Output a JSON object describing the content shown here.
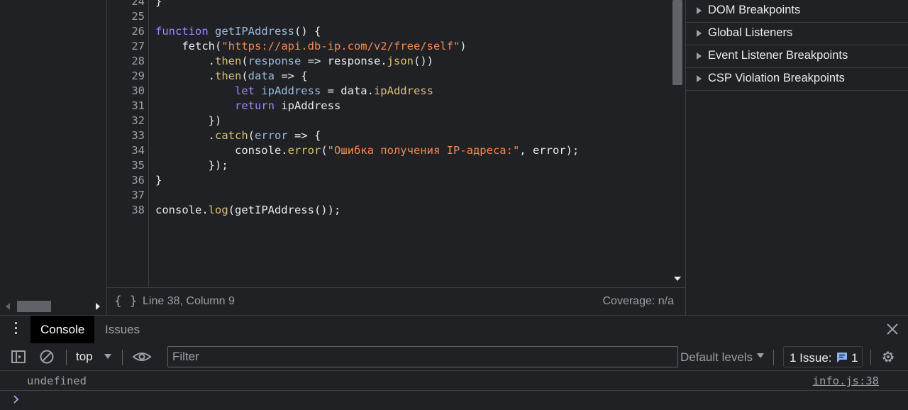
{
  "editor": {
    "lines": [
      {
        "n": "24",
        "tokens": [
          {
            "c": "plain",
            "t": "}"
          }
        ]
      },
      {
        "n": "25",
        "tokens": []
      },
      {
        "n": "26",
        "tokens": [
          {
            "c": "kw",
            "t": "function "
          },
          {
            "c": "var",
            "t": "getIPAddress"
          },
          {
            "c": "plain",
            "t": "() {"
          }
        ]
      },
      {
        "n": "27",
        "tokens": [
          {
            "c": "plain",
            "t": "    fetch("
          },
          {
            "c": "str",
            "t": "\"https://api.db-ip.com/v2/free/self\""
          },
          {
            "c": "plain",
            "t": ")"
          }
        ]
      },
      {
        "n": "28",
        "tokens": [
          {
            "c": "plain",
            "t": "        ."
          },
          {
            "c": "prop",
            "t": "then"
          },
          {
            "c": "plain",
            "t": "("
          },
          {
            "c": "var",
            "t": "response"
          },
          {
            "c": "plain",
            "t": " => response."
          },
          {
            "c": "prop",
            "t": "json"
          },
          {
            "c": "plain",
            "t": "())"
          }
        ]
      },
      {
        "n": "29",
        "tokens": [
          {
            "c": "plain",
            "t": "        ."
          },
          {
            "c": "prop",
            "t": "then"
          },
          {
            "c": "plain",
            "t": "("
          },
          {
            "c": "var",
            "t": "data"
          },
          {
            "c": "plain",
            "t": " => {"
          }
        ]
      },
      {
        "n": "30",
        "tokens": [
          {
            "c": "plain",
            "t": "            "
          },
          {
            "c": "kw",
            "t": "let "
          },
          {
            "c": "var",
            "t": "ipAddress"
          },
          {
            "c": "plain",
            "t": " = data."
          },
          {
            "c": "prop",
            "t": "ipAddress"
          }
        ]
      },
      {
        "n": "31",
        "tokens": [
          {
            "c": "plain",
            "t": "            "
          },
          {
            "c": "kw",
            "t": "return "
          },
          {
            "c": "plain",
            "t": "ipAddress"
          }
        ]
      },
      {
        "n": "32",
        "tokens": [
          {
            "c": "plain",
            "t": "        })"
          }
        ]
      },
      {
        "n": "33",
        "tokens": [
          {
            "c": "plain",
            "t": "        ."
          },
          {
            "c": "prop",
            "t": "catch"
          },
          {
            "c": "plain",
            "t": "("
          },
          {
            "c": "var",
            "t": "error"
          },
          {
            "c": "plain",
            "t": " => {"
          }
        ]
      },
      {
        "n": "34",
        "tokens": [
          {
            "c": "plain",
            "t": "            console."
          },
          {
            "c": "prop",
            "t": "error"
          },
          {
            "c": "plain",
            "t": "("
          },
          {
            "c": "str",
            "t": "\"Ошибка получения IP-адреса:\""
          },
          {
            "c": "plain",
            "t": ", error);"
          }
        ]
      },
      {
        "n": "35",
        "tokens": [
          {
            "c": "plain",
            "t": "        });"
          }
        ]
      },
      {
        "n": "36",
        "tokens": [
          {
            "c": "plain",
            "t": "}"
          }
        ]
      },
      {
        "n": "37",
        "tokens": []
      },
      {
        "n": "38",
        "tokens": [
          {
            "c": "plain",
            "t": "console."
          },
          {
            "c": "prop",
            "t": "log"
          },
          {
            "c": "plain",
            "t": "(getIPAddress());"
          }
        ]
      }
    ]
  },
  "status_bar": {
    "braces": "{ }",
    "position": "Line 38, Column 9",
    "coverage": "Coverage: n/a"
  },
  "sidebar": {
    "items": [
      {
        "label": "DOM Breakpoints"
      },
      {
        "label": "Global Listeners"
      },
      {
        "label": "Event Listener Breakpoints"
      },
      {
        "label": "CSP Violation Breakpoints"
      }
    ]
  },
  "drawer": {
    "tabs": [
      {
        "label": "Console",
        "active": true
      },
      {
        "label": "Issues",
        "active": false
      }
    ]
  },
  "console_toolbar": {
    "context": "top",
    "filter_placeholder": "Filter",
    "levels": "Default levels",
    "issues_label": "1 Issue:",
    "issues_count": "1"
  },
  "console_output": {
    "value": "undefined",
    "source": "info.js:38"
  },
  "icons": {
    "sidebar_toggle": "sidebar-toggle-icon",
    "clear": "clear-console-icon",
    "eye": "live-expression-icon",
    "gear": "gear-icon",
    "close": "close-icon",
    "issue": "issue-message-icon",
    "prompt": "chevron-right-icon"
  },
  "colors": {
    "background": "#202124",
    "keyword": "#9f86ff",
    "string": "#f28b54",
    "property": "#d8c16e",
    "variable": "#9bbbdc",
    "accent": "#8ab4f8"
  }
}
